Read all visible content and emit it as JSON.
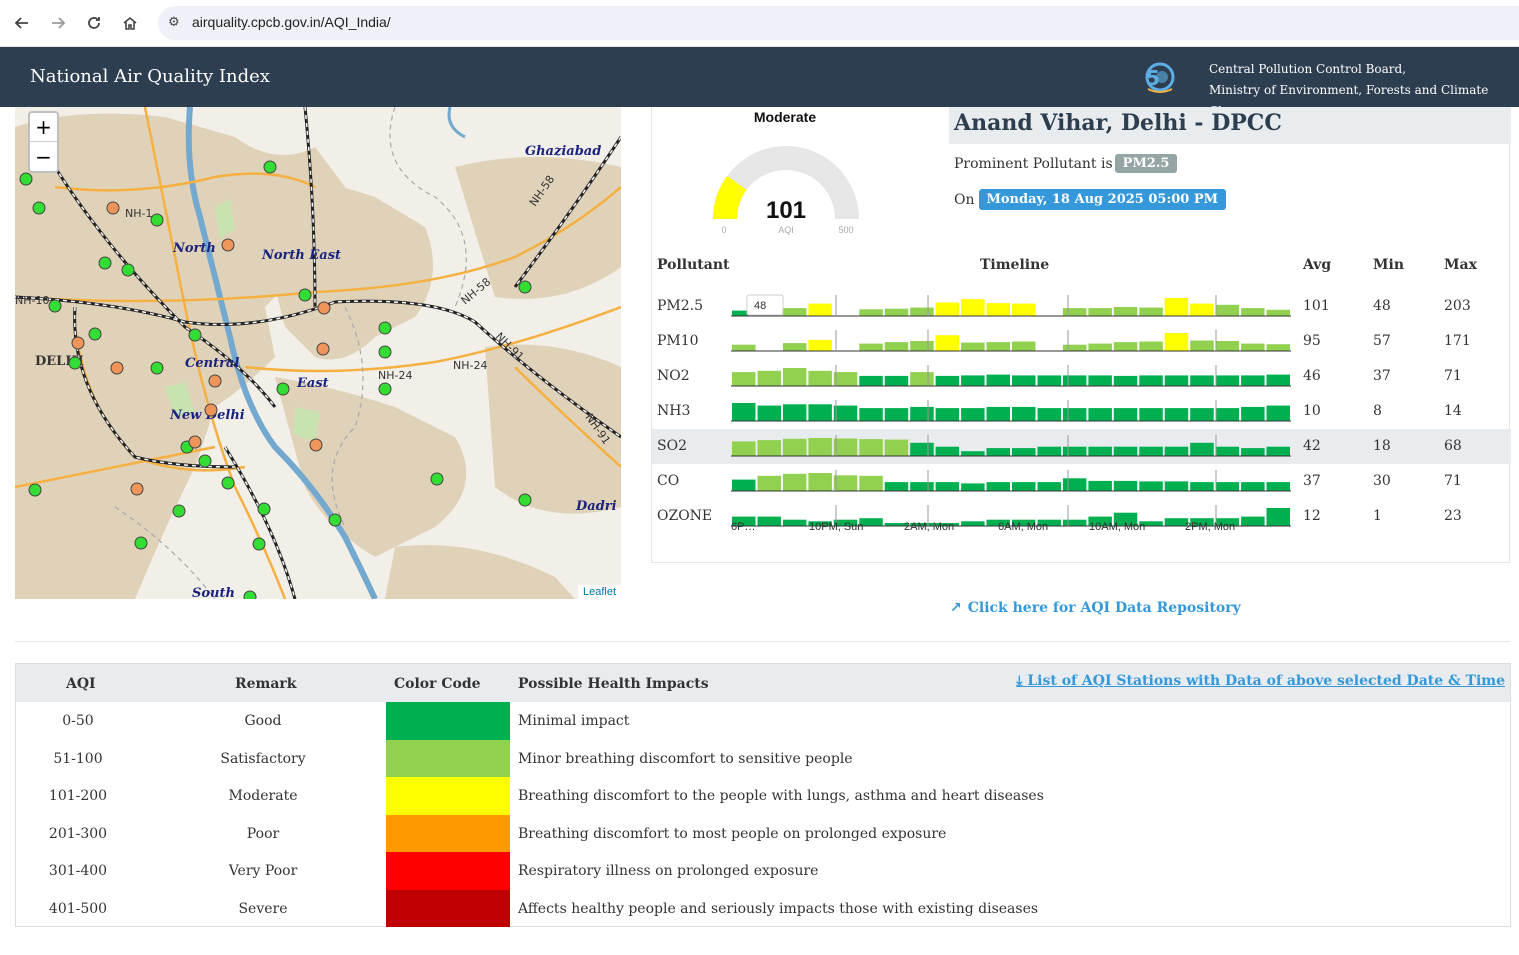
{
  "browser": {
    "url": "airquality.cpcb.gov.in/AQI_India/",
    "back_icon": "arrow-left-icon",
    "forward_icon": "arrow-right-icon",
    "reload_icon": "reload-icon",
    "home_icon": "home-icon"
  },
  "header": {
    "title": "National Air Quality Index",
    "org_line1": "Central Pollution Control Board,",
    "org_line2": "Ministry of Environment, Forests and Climate Change",
    "bg": "#2c3e50"
  },
  "map": {
    "zoom_in": "+",
    "zoom_out": "−",
    "attribution": "Leaflet",
    "labels": [
      "Ghaziabad",
      "North",
      "North East",
      "DELHI",
      "Central",
      "East",
      "New Delhi",
      "South",
      "Dadri",
      "NH-1",
      "NH-10",
      "NH-24",
      "NH-58",
      "NH-91"
    ]
  },
  "gauge": {
    "category": "Moderate",
    "value": "101",
    "min": "0",
    "max": "500",
    "unit": "AQI",
    "fill_fraction": 0.202,
    "fill_color": "#ffff00"
  },
  "station": {
    "name": "Anand Vihar, Delhi - DPCC",
    "prominent_label": "Prominent Pollutant is",
    "prominent_value": "PM2.5",
    "on_label": "On",
    "datetime": "Monday, 18 Aug 2025 05:00 PM"
  },
  "pollutant_table": {
    "headers": {
      "pollutant": "Pollutant",
      "timeline": "Timeline",
      "avg": "Avg",
      "min": "Min",
      "max": "Max"
    },
    "tooltip": "48",
    "axis_labels": [
      "6P…",
      "10PM, Sun",
      "2AM, Mon",
      "6AM, Mon",
      "10AM, Mon",
      "2PM, Mon"
    ],
    "rows": [
      {
        "name": "PM2.5",
        "avg": "101",
        "min": "48",
        "max": "203",
        "series": [
          48,
          0,
          70,
          110,
          0,
          60,
          65,
          75,
          120,
          150,
          115,
          110,
          0,
          70,
          70,
          80,
          75,
          160,
          110,
          100,
          70,
          55
        ]
      },
      {
        "name": "PM10",
        "avg": "95",
        "min": "57",
        "max": "171",
        "series": [
          60,
          0,
          75,
          105,
          0,
          70,
          85,
          95,
          150,
          80,
          85,
          90,
          0,
          60,
          70,
          85,
          90,
          171,
          100,
          95,
          70,
          65
        ]
      },
      {
        "name": "NO2",
        "avg": "46",
        "min": "37",
        "max": "71",
        "series": [
          55,
          60,
          71,
          60,
          55,
          40,
          40,
          55,
          40,
          42,
          45,
          42,
          42,
          42,
          42,
          40,
          42,
          42,
          42,
          42,
          42,
          45
        ]
      },
      {
        "name": "NH3",
        "avg": "10",
        "min": "8",
        "max": "14",
        "series": [
          14,
          12,
          13,
          13,
          12,
          10,
          10,
          11,
          10,
          10,
          11,
          11,
          10,
          10,
          10,
          10,
          10,
          10,
          10,
          10,
          11,
          12
        ]
      },
      {
        "name": "SO2",
        "avg": "42",
        "min": "18",
        "max": "68",
        "series": [
          55,
          60,
          65,
          68,
          66,
          64,
          62,
          50,
          35,
          18,
          30,
          30,
          35,
          35,
          35,
          35,
          35,
          35,
          50,
          35,
          30,
          35
        ]
      },
      {
        "name": "CO",
        "avg": "37",
        "min": "30",
        "max": "71",
        "series": [
          45,
          60,
          68,
          71,
          62,
          60,
          35,
          35,
          35,
          30,
          35,
          35,
          35,
          50,
          40,
          40,
          38,
          38,
          35,
          35,
          35,
          35
        ]
      },
      {
        "name": "OZONE",
        "avg": "12",
        "min": "1",
        "max": "23",
        "series": [
          12,
          12,
          8,
          6,
          8,
          10,
          1,
          2,
          2,
          6,
          8,
          8,
          8,
          8,
          12,
          17,
          6,
          10,
          10,
          10,
          12,
          23
        ]
      }
    ]
  },
  "repo_link": "Click here for AQI Data Repository",
  "aqi_table": {
    "headers": {
      "aqi": "AQI",
      "remark": "Remark",
      "color": "Color Code",
      "impact": "Possible Health Impacts"
    },
    "download_link": "List of AQI Stations with Data of above selected Date & Time",
    "rows": [
      {
        "range": "0-50",
        "remark": "Good",
        "color": "#00b050",
        "impact": "Minimal impact"
      },
      {
        "range": "51-100",
        "remark": "Satisfactory",
        "color": "#92d050",
        "impact": "Minor breathing discomfort to sensitive people"
      },
      {
        "range": "101-200",
        "remark": "Moderate",
        "color": "#ffff00",
        "impact": "Breathing discomfort to the people with lungs, asthma and heart diseases"
      },
      {
        "range": "201-300",
        "remark": "Poor",
        "color": "#ff9900",
        "impact": "Breathing discomfort to most people on prolonged exposure"
      },
      {
        "range": "301-400",
        "remark": "Very Poor",
        "color": "#ff0000",
        "impact": "Respiratory illness on prolonged exposure"
      },
      {
        "range": "401-500",
        "remark": "Severe",
        "color": "#c00000",
        "impact": "Affects healthy people and seriously impacts those with existing diseases"
      }
    ]
  }
}
